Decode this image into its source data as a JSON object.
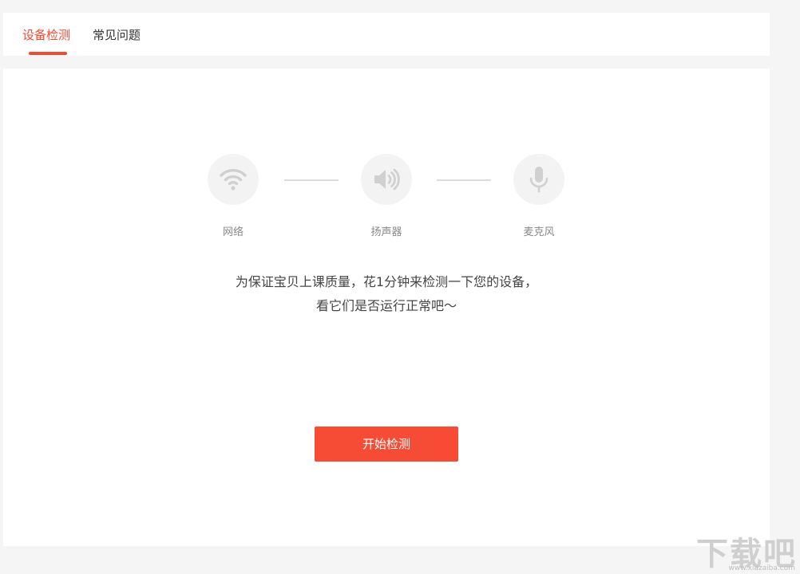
{
  "tabs": [
    {
      "label": "设备检测",
      "active": true
    },
    {
      "label": "常见问题",
      "active": false
    }
  ],
  "steps": [
    {
      "label": "网络",
      "icon": "wifi-icon"
    },
    {
      "label": "扬声器",
      "icon": "speaker-icon"
    },
    {
      "label": "麦克风",
      "icon": "microphone-icon"
    }
  ],
  "message": {
    "line1": "为保证宝贝上课质量，花1分钟来检测一下您的设备，",
    "line2": "看它们是否运行正常吧～"
  },
  "start_button": {
    "label": "开始检测"
  },
  "watermark": {
    "text": "下载吧",
    "url": "www.xiazaiba.com"
  },
  "colors": {
    "accent": "#f04a33",
    "button": "#f64c35",
    "icon_gray": "#d0d0d0"
  }
}
